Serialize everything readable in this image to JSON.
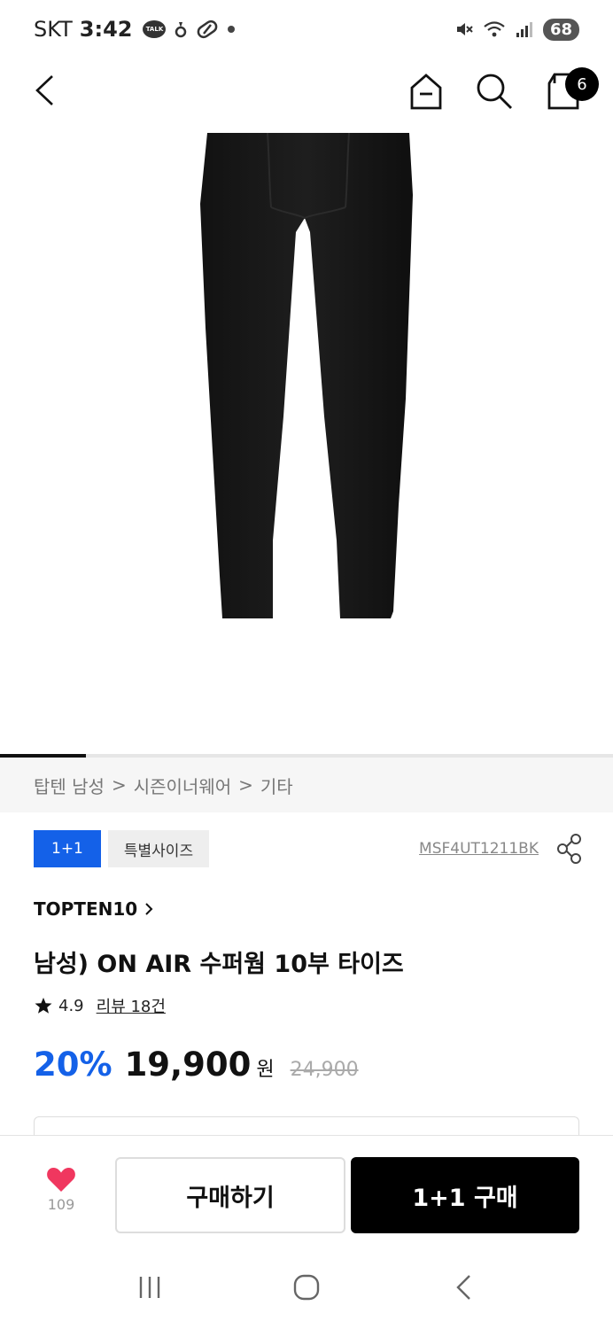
{
  "status_bar": {
    "carrier": "SKT",
    "time": "3:42",
    "talk_label": "TALK",
    "battery": "68"
  },
  "header": {
    "cart_count": "6"
  },
  "breadcrumb": [
    "탑텐 남성",
    "시즌이너웨어",
    "기타"
  ],
  "breadcrumb_separator": ">",
  "image_slider": {
    "progress": 0.14
  },
  "tags": {
    "promo": "1+1",
    "special": "특별사이즈"
  },
  "sku": "MSF4UT1211BK",
  "brand": "TOPTEN10",
  "product": {
    "title": "남성) ON AIR 수퍼웜 10부 타이즈",
    "rating": "4.9",
    "review_link": "리뷰 18건"
  },
  "price": {
    "discount": "20%",
    "sale_price": "19,900",
    "currency": "원",
    "original_price": "24,900"
  },
  "bottom_bar": {
    "wish_count": "109",
    "buy_label": "구매하기",
    "bundle_label": "1+1 구매"
  },
  "colors": {
    "accent_blue": "#1461e8",
    "heart": "#f0375f",
    "black": "#000000"
  },
  "icons": {
    "back": "chevron-left-icon",
    "home": "home-icon",
    "search": "search-icon",
    "cart": "shopping-bag-icon",
    "share": "share-icon",
    "star": "star-icon",
    "wish": "heart-icon"
  }
}
